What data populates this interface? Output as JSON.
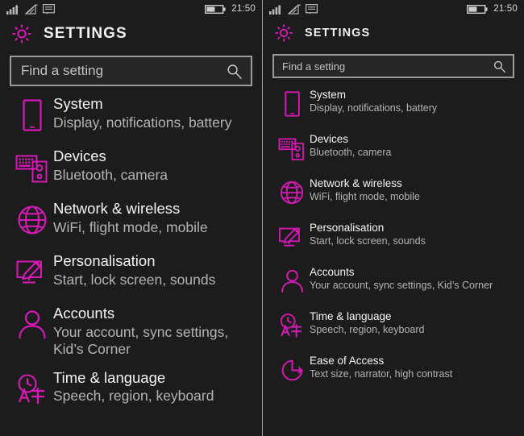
{
  "theme": {
    "background": "#1c1c1c",
    "accent": "#d619b6",
    "title_color": "#f4f4f4",
    "subtitle_color": "#b4b4b4",
    "search_border": "#9b9b9b",
    "search_background": "#262626",
    "divider": "#9a9a9a"
  },
  "statusbar": {
    "icons": [
      "signal-bars-icon",
      "wifi-icon",
      "sms-icon"
    ],
    "battery_icon": "battery-icon",
    "time": "21:50"
  },
  "header": {
    "gear_icon": "gear-icon",
    "title": "SETTINGS"
  },
  "search": {
    "placeholder": "Find a setting",
    "value": "",
    "icon": "search-icon"
  },
  "settings_items": [
    {
      "icon": "phone-icon",
      "title": "System",
      "subtitle": "Display, notifications, battery"
    },
    {
      "icon": "devices-icon",
      "title": "Devices",
      "subtitle": "Bluetooth, camera"
    },
    {
      "icon": "globe-icon",
      "title": "Network & wireless",
      "subtitle": "WiFi, flight mode, mobile"
    },
    {
      "icon": "personalisation-icon",
      "title": "Personalisation",
      "subtitle": "Start, lock screen, sounds"
    },
    {
      "icon": "account-icon",
      "title": "Accounts",
      "subtitle": "Your account, sync settings, Kid’s Corner"
    },
    {
      "icon": "time-language-icon",
      "title": "Time & language",
      "subtitle": "Speech, region, keyboard"
    },
    {
      "icon": "ease-of-access-icon",
      "title": "Ease of Access",
      "subtitle": "Text size, narrator, high contrast"
    }
  ],
  "panels": {
    "left": {
      "visible_item_count": 6,
      "accounts_subtitle_wrapped": [
        "Your account, sync settings,",
        "Kid’s Corner"
      ]
    },
    "right": {
      "visible_item_count": 7
    }
  }
}
